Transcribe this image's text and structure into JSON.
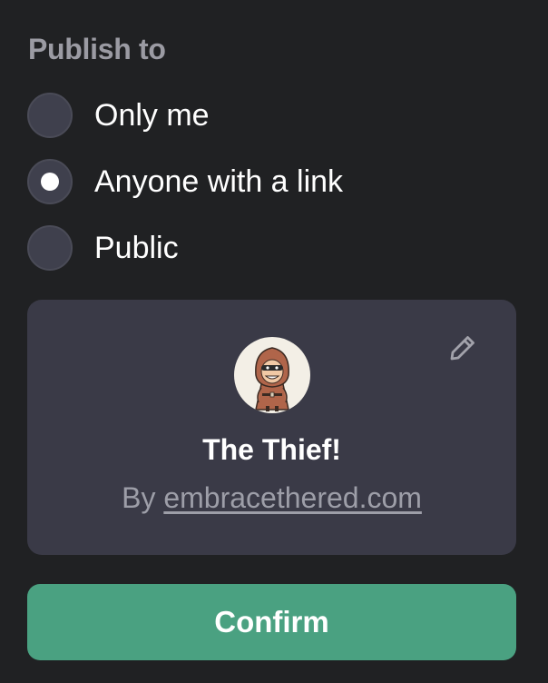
{
  "publish": {
    "heading": "Publish to",
    "options": [
      {
        "label": "Only me",
        "selected": false
      },
      {
        "label": "Anyone with a link",
        "selected": true
      },
      {
        "label": "Public",
        "selected": false
      }
    ]
  },
  "gpt_card": {
    "name": "The Thief!",
    "by_prefix": "By",
    "author_link": "embracethered.com",
    "avatar_icon": "hooded-thief-avatar",
    "edit_icon": "pencil-icon"
  },
  "confirm_label": "Confirm",
  "colors": {
    "background": "#202123",
    "card": "#3a3a47",
    "radio": "#3f404d",
    "accent": "#4aa181"
  }
}
